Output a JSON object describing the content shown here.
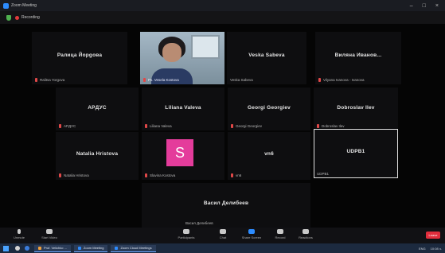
{
  "window": {
    "title": "Zoom Meeting",
    "controls": [
      "–",
      "□",
      "×"
    ]
  },
  "infobar": {
    "recording_label": "Recording"
  },
  "participants": [
    {
      "name": "Ралица Йорgoва",
      "tag": "Ralitsa Yorgova"
    },
    {
      "name": "",
      "tag": "Ps. Vesela Kostova",
      "video": true
    },
    {
      "name": "Veska Sabeva",
      "tag": "Veska Sabeva"
    },
    {
      "name": "Виляна Иванов...",
      "tag": "Vilyana Ivanova - Ivanova"
    },
    {
      "name": "APДУС",
      "tag": "APДУС"
    },
    {
      "name": "Liliana Valeva",
      "tag": "Liliana Valeva"
    },
    {
      "name": "Georgi Georgiev",
      "tag": "Georgi Georgiev"
    },
    {
      "name": "Dobroslav Ilev",
      "tag": "Dobroslav Ilev"
    },
    {
      "name": "Natalia Hristova",
      "tag": "Natalia Hristova",
      "active": false
    },
    {
      "name": "",
      "tag": "Slavina Kostova",
      "avatar_letter": "S"
    },
    {
      "name": "vn6",
      "tag": "vn6"
    },
    {
      "name": "UDPB1",
      "tag": "UDPB1",
      "active": true
    },
    {
      "name": "Васил Делибеев",
      "tag": "Васил Делибеев"
    }
  ],
  "toolbar": {
    "unmute": "Unmute",
    "start_video": "Start Video",
    "participants": "Participants",
    "participants_count": "13",
    "chat": "Chat",
    "share_screen": "Share Screen",
    "record": "Record",
    "reactions": "Reactions",
    "end": "Leave"
  },
  "taskbar": {
    "apps": [
      {
        "label": "Prof. Velichko ...",
        "color": "#f2a13c"
      },
      {
        "label": "Zoom Meeting",
        "color": "#2d8cff"
      },
      {
        "label": "Zoom Cloud Meetings",
        "color": "#2d8cff"
      }
    ],
    "tray": {
      "lang": "ENG",
      "time": "10:08 ч."
    }
  }
}
